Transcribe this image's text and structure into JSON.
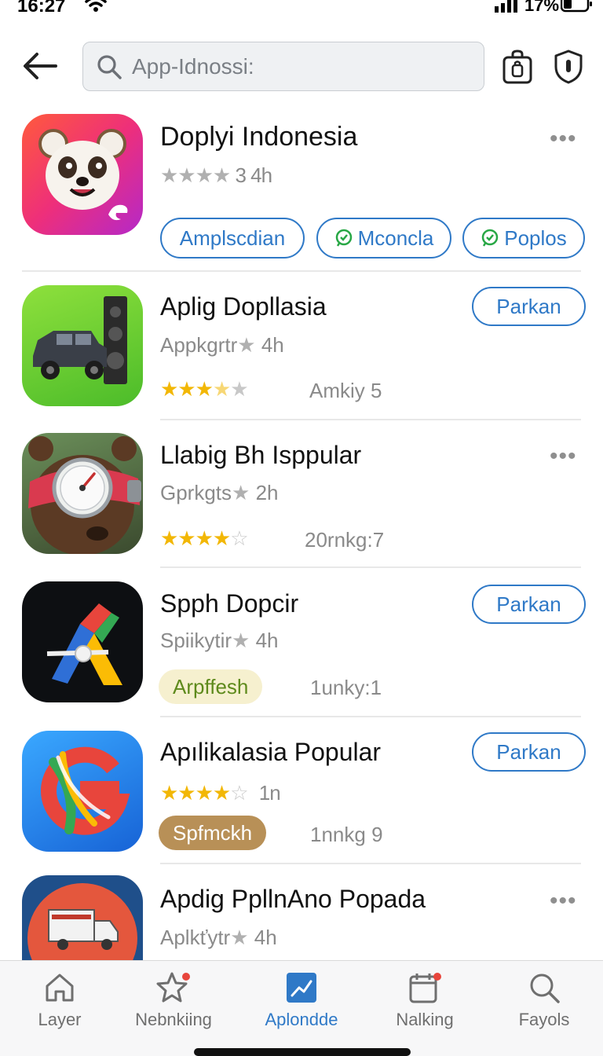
{
  "status_bar": {
    "time": "16:27",
    "battery": "17%"
  },
  "search": {
    "placeholder": "App-Idnossi:"
  },
  "apps": [
    {
      "title": "Doplyi Indonesia",
      "meta": "3 4h",
      "tags": [
        "Amplscdian",
        "Mconcla",
        "Poplos"
      ]
    },
    {
      "title": "Aplig Dopllasia",
      "meta": "Appkgrtr",
      "meta_time": "4h",
      "ranking": "Amkiy 5",
      "action": "Parkan",
      "rating": 3.5
    },
    {
      "title": "Llabig Bh Isppular",
      "meta": "Gprkgts",
      "meta_time": "2h",
      "ranking": "20rnkg:7",
      "rating": 4.5
    },
    {
      "title": "Spph Dopcir",
      "meta": "Spiikytir",
      "meta_time": "4h",
      "badge": "Arpffesh",
      "ranking": "1unky:1",
      "action": "Parkan"
    },
    {
      "title": "Apılikalasia Popular",
      "meta_time": "1n",
      "badge": "Spfmckh",
      "ranking": "1nnkg 9",
      "action": "Parkan",
      "rating": 4.5
    },
    {
      "title": "Apdig PpllnAno Popada",
      "meta": "Aplkťytr",
      "meta_time": "4h"
    }
  ],
  "nav": [
    {
      "label": "Layer",
      "icon": "home-icon"
    },
    {
      "label": "Nebnkiing",
      "icon": "star-icon"
    },
    {
      "label": "Aplondde",
      "icon": "trending-icon",
      "active": true
    },
    {
      "label": "Nalking",
      "icon": "calendar-icon"
    },
    {
      "label": "Fayols",
      "icon": "search-icon"
    }
  ],
  "colors": {
    "accent": "#2f79c7",
    "star": "#f2b705",
    "badge_cream": "#f6f0cf",
    "badge_brown": "#b89057"
  }
}
